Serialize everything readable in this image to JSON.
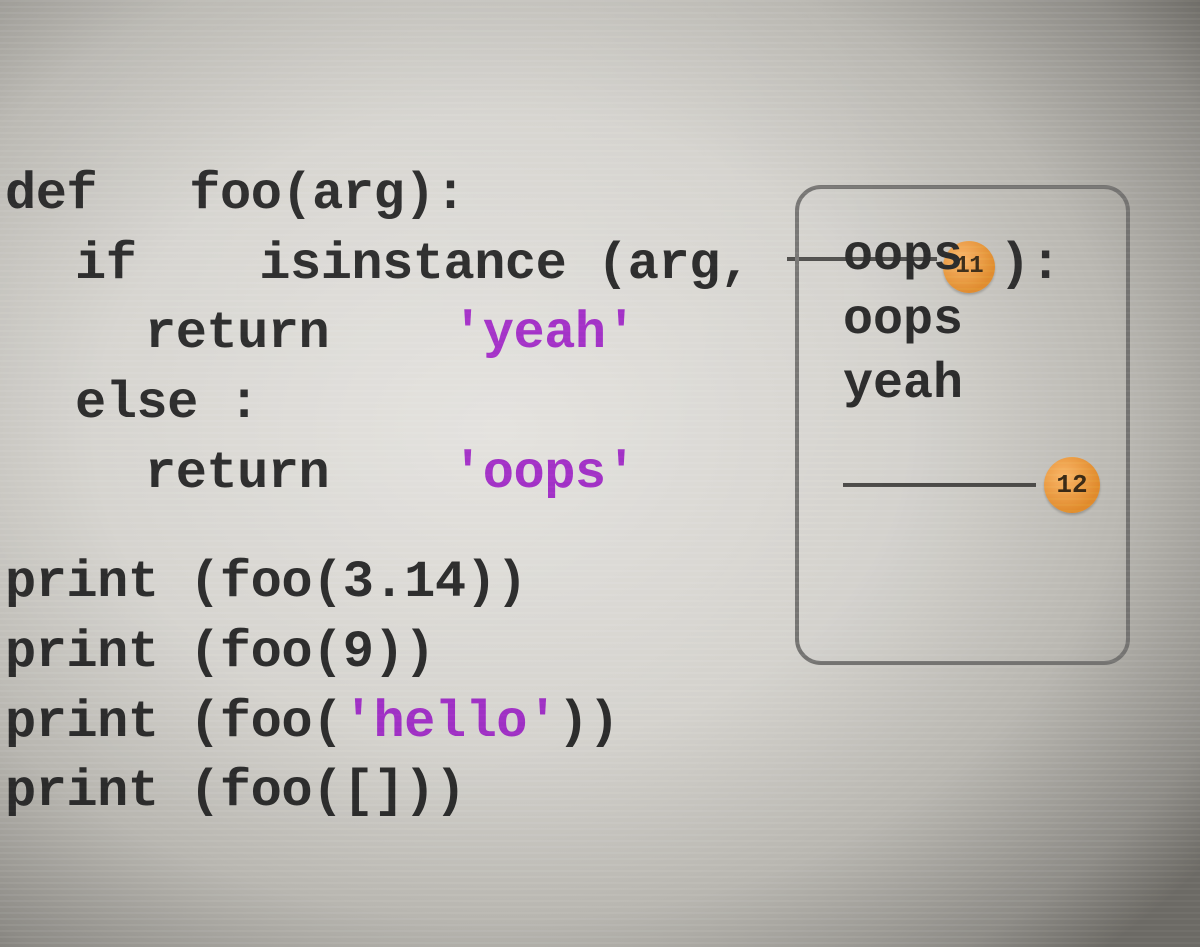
{
  "code": {
    "l1_def": "def",
    "l1_fn": "foo",
    "l1_rest": "(arg):",
    "l2_if": "if",
    "l2_call": "isinstance (arg,",
    "l2_close": "):",
    "l3_return": "return",
    "l3_str": "'yeah'",
    "l4_else": "else :",
    "l5_return": "return",
    "l5_str": "'oops'",
    "l6": "print (foo(3.14))",
    "l7": "print (foo(9))",
    "l8a": "print (foo(",
    "l8_str": "'hello'",
    "l8b": "))",
    "l9": "print (foo([]))"
  },
  "badges": {
    "blank11": "11",
    "blank12": "12"
  },
  "output": {
    "o1": "oops",
    "o2": "oops",
    "o3": "yeah"
  }
}
